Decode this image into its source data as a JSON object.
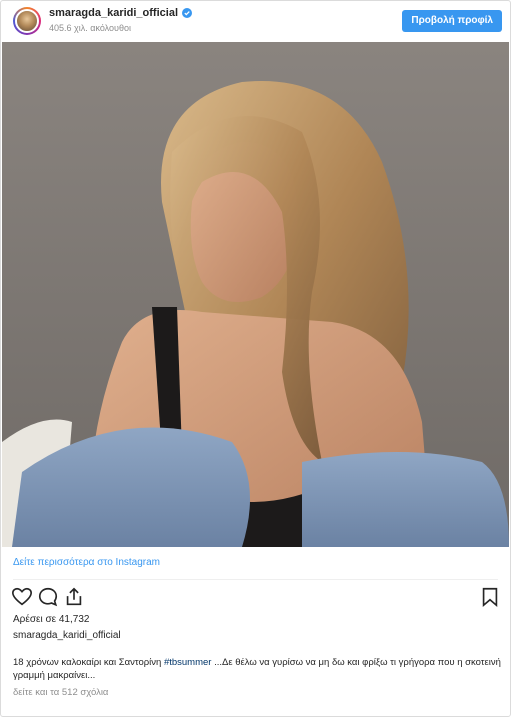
{
  "header": {
    "username": "smaragda_karidi_official",
    "followers": "405.6 χιλ. ακόλουθοι",
    "profile_button": "Προβολή προφίλ"
  },
  "post": {
    "see_more": "Δείτε περισσότερα στο Instagram",
    "likes": "Αρέσει σε 41,732",
    "owner": "smaragda_karidi_official",
    "caption_before": "18 χρόνων καλοκαίρι και Σαντορίνη ",
    "hashtag": "#tbsummer",
    "caption_after": " ...Δε θέλω να γυρίσω να μη δω και φρίξω τι γρήγορα που η σκοτεινή γραμμή μακραίνει...",
    "comments": "δείτε και τα 512 σχόλια"
  },
  "icons": {
    "verified": "verified-badge-icon",
    "like": "heart-icon",
    "comment": "comment-bubble-icon",
    "share": "share-icon",
    "save": "bookmark-icon"
  },
  "colors": {
    "accent": "#3897f0",
    "hashtag": "#003569",
    "muted": "#8e8e8e",
    "text": "#262626"
  }
}
